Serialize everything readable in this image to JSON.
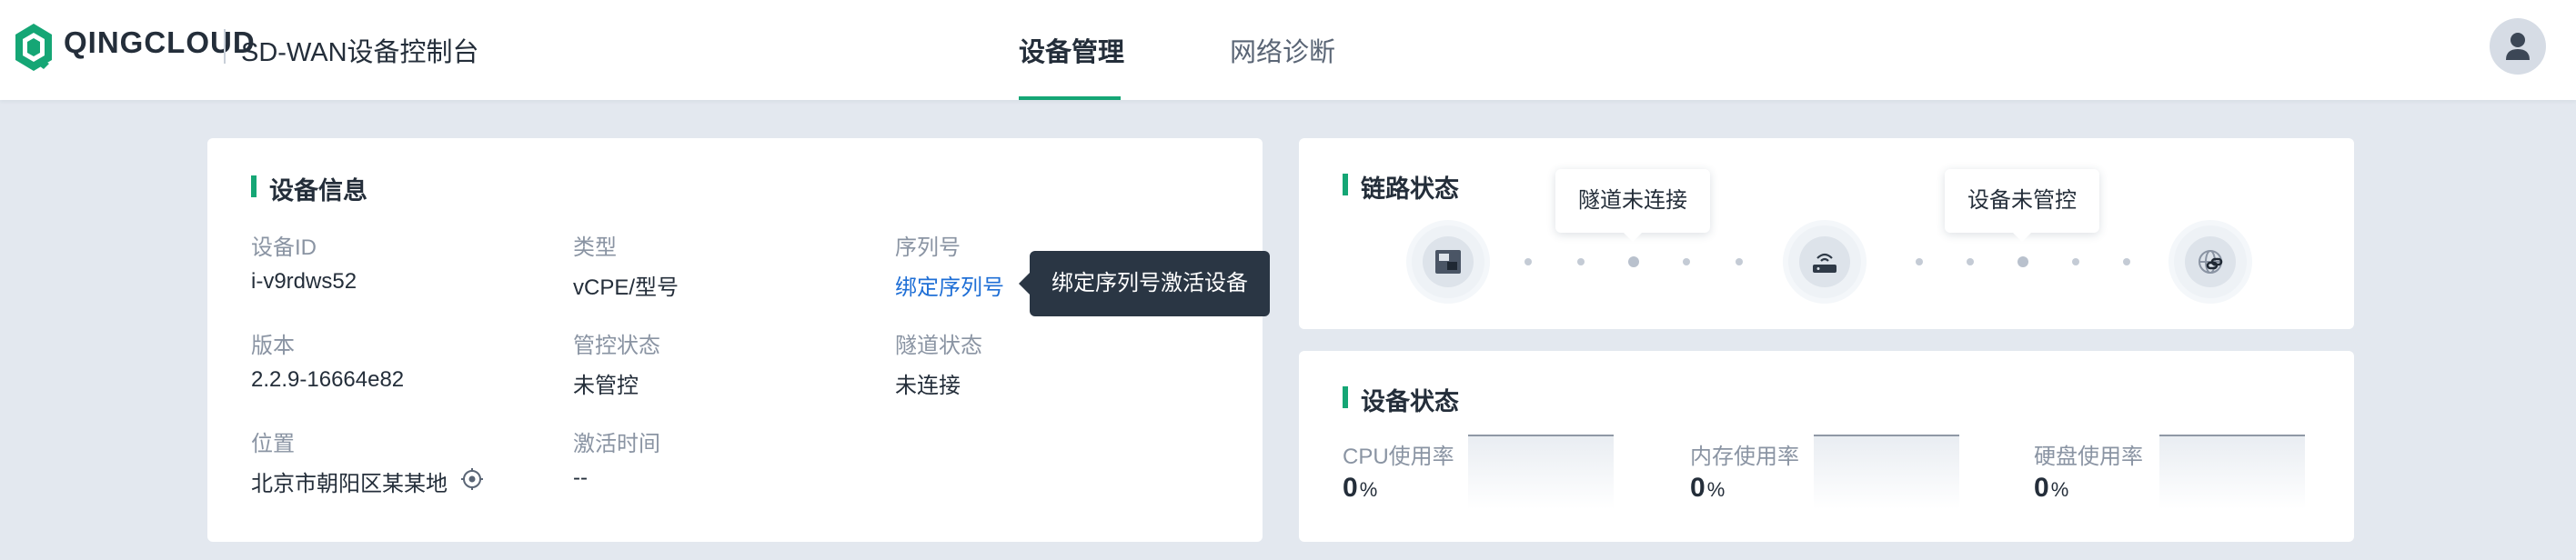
{
  "header": {
    "brand": "QINGCLOUD",
    "product": "SD-WAN设备控制台",
    "tabs": [
      {
        "label": "设备管理",
        "active": true
      },
      {
        "label": "网络诊断",
        "active": false
      }
    ],
    "accent_color": "#15a675"
  },
  "device_info": {
    "title": "设备信息",
    "fields": {
      "device_id": {
        "label": "设备ID",
        "value": "i-v9rdws52"
      },
      "type": {
        "label": "类型",
        "value": "vCPE/型号"
      },
      "serial": {
        "label": "序列号",
        "value": "绑定序列号"
      },
      "version": {
        "label": "版本",
        "value": "2.2.9-16664e82"
      },
      "control_status": {
        "label": "管控状态",
        "value": "未管控"
      },
      "tunnel_status": {
        "label": "隧道状态",
        "value": "未连接"
      },
      "location": {
        "label": "位置",
        "value": "北京市朝阳区某某地"
      },
      "activation_time": {
        "label": "激活时间",
        "value": "--"
      }
    },
    "serial_tooltip": "绑定序列号激活设备"
  },
  "link_status": {
    "title": "链路状态",
    "tunnel_bubble": "隧道未连接",
    "control_bubble": "设备未管控",
    "icons": [
      "device-icon",
      "router-icon",
      "cloud-link-icon"
    ]
  },
  "device_status": {
    "title": "设备状态",
    "metrics": [
      {
        "label": "CPU使用率",
        "value": "0",
        "unit": "%"
      },
      {
        "label": "内存使用率",
        "value": "0",
        "unit": "%"
      },
      {
        "label": "硬盘使用率",
        "value": "0",
        "unit": "%"
      }
    ]
  }
}
